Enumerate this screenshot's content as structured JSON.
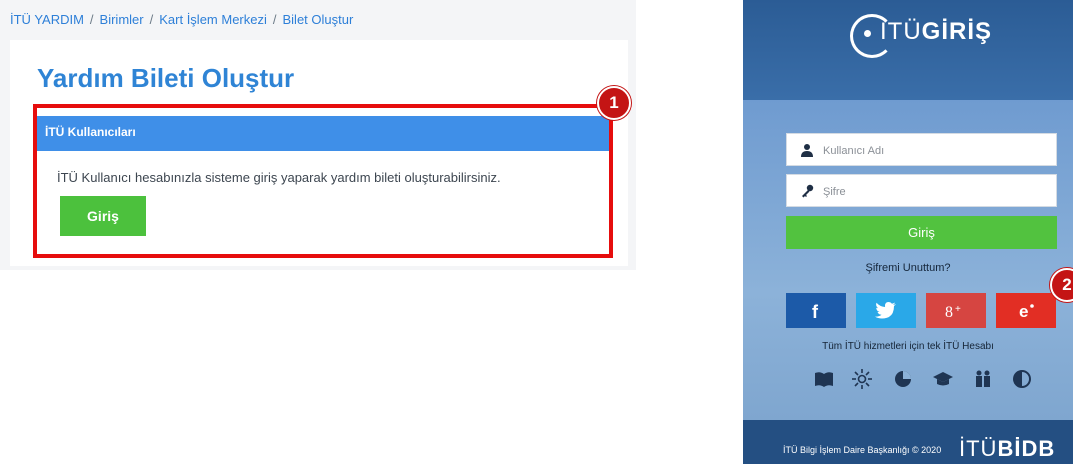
{
  "help_page": {
    "breadcrumb": [
      "İTÜ YARDIM",
      "Birimler",
      "Kart İşlem Merkezi",
      "Bilet Oluştur"
    ],
    "breadcrumb_separator": "/",
    "title": "Yardım Bileti Oluştur",
    "panel": {
      "header": "İTÜ Kullanıcıları",
      "text": "İTÜ Kullanıcı hesabınızla sisteme giriş yaparak yardım bileti oluşturabilirsiniz.",
      "button_label": "Giriş"
    },
    "marker": "1"
  },
  "login_page": {
    "logo_light": "İTÜ",
    "logo_bold": "GİRİŞ",
    "username_placeholder": "Kullanıcı Adı",
    "password_placeholder": "Şifre",
    "login_button": "Giriş",
    "forgot_link": "Şifremi Unuttum?",
    "social": [
      {
        "name": "facebook",
        "glyph": "f",
        "color": "#1c5aa8"
      },
      {
        "name": "twitter",
        "glyph": "twitter-bird",
        "color": "#2aa8e8"
      },
      {
        "name": "google-plus",
        "glyph": "8+",
        "color": "#d64541"
      },
      {
        "name": "e-devlet",
        "glyph": "e",
        "color": "#e22e24"
      }
    ],
    "marker": "2",
    "tagline": "Tüm İTÜ hizmetleri için tek İTÜ Hesabı",
    "service_icons": [
      "book-icon",
      "sun-icon",
      "pie-chart-icon",
      "graduation-cap-icon",
      "people-icon",
      "contrast-icon"
    ],
    "footer_text": "İTÜ Bilgi İşlem Daire Başkanlığı © 2020",
    "footer_brand_light": "İTÜ",
    "footer_brand_bold": "BİDB"
  },
  "colors": {
    "link_blue": "#2d7fd8",
    "panel_header_blue": "#3f8fe8",
    "button_green": "#4cc13d",
    "highlight_red": "#e60d0d",
    "marker_red": "#c41414"
  }
}
